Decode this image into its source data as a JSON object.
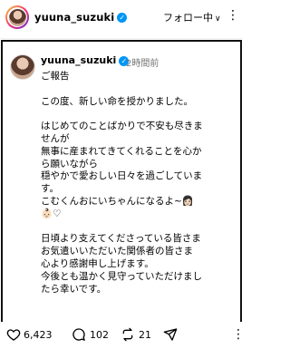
{
  "header": {
    "username": "yuuna_suzuki",
    "follow_label": "フォロー中",
    "follow_chevron": "∨",
    "more": "⋮"
  },
  "post": {
    "username": "yuuna_suzuki",
    "time": "2時間前",
    "caption_lines": [
      "ご報告",
      "",
      "この度、新しい命を授かりました。",
      "",
      "はじめてのことばかりで不安も尽きま",
      "せんが",
      "無事に産まれてきてくれることを心か",
      "ら願いながら",
      "穏やかで愛おしい日々を過ごしていま",
      "す。",
      "こむくんおにいちゃんになるよ~👩🏻",
      "👶🏻♡",
      "",
      "日頃より支えてくださっている皆さま",
      "お気遣いいただいた関係者の皆さま",
      "心より感謝申し上げます。",
      "今後とも温かく見守っていただけまし",
      "たら幸いです。"
    ]
  },
  "actions": {
    "likes": "6,423",
    "comments": "102",
    "reposts": "21",
    "more": "⋮"
  },
  "icons": [
    "verified-icon",
    "heart-icon",
    "comment-icon",
    "repost-icon",
    "share-icon",
    "more-icon"
  ]
}
